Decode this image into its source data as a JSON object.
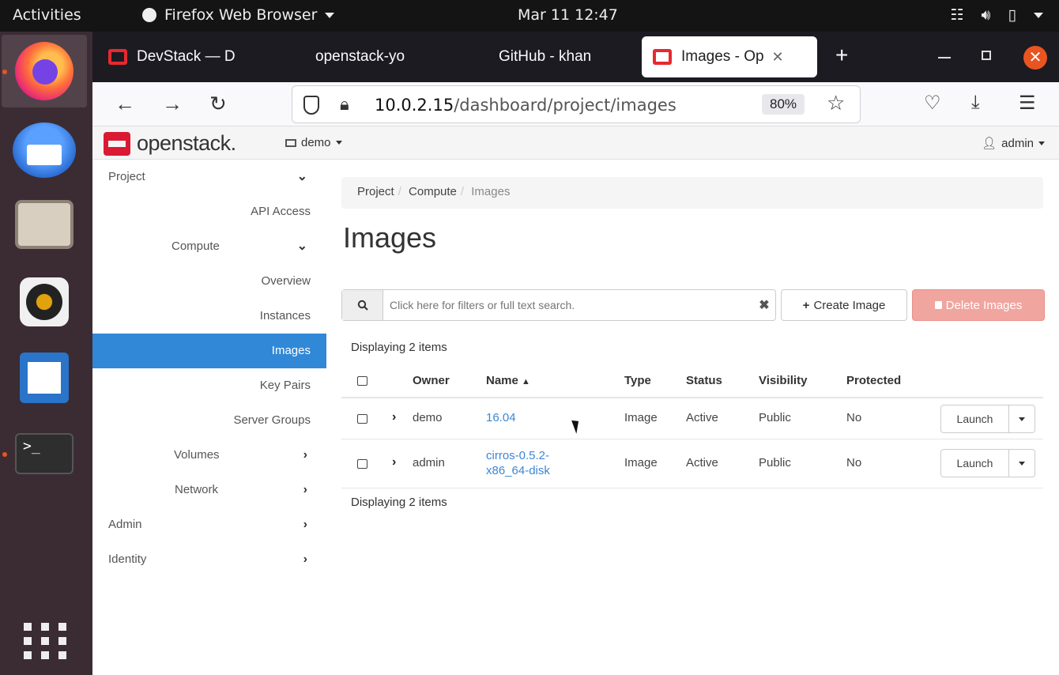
{
  "topbar": {
    "activities": "Activities",
    "app_menu": "Firefox Web Browser",
    "clock": "Mar 11  12:47"
  },
  "browser": {
    "tabs": [
      {
        "label": "DevStack — D"
      },
      {
        "label": "openstack-yo"
      },
      {
        "label": "GitHub - khan"
      },
      {
        "label": "Images - Op"
      }
    ],
    "url_host": "10.0.2.15",
    "url_path": "/dashboard/project/images",
    "zoom": "80%"
  },
  "header": {
    "logo_text": "openstack.",
    "project": "demo",
    "user": "admin"
  },
  "sidebar": {
    "items": [
      {
        "label": "Project"
      },
      {
        "label": "API Access"
      },
      {
        "label": "Compute"
      },
      {
        "label": "Overview"
      },
      {
        "label": "Instances"
      },
      {
        "label": "Images"
      },
      {
        "label": "Key Pairs"
      },
      {
        "label": "Server Groups"
      },
      {
        "label": "Volumes"
      },
      {
        "label": "Network"
      },
      {
        "label": "Admin"
      },
      {
        "label": "Identity"
      }
    ]
  },
  "main": {
    "breadcrumb": [
      "Project",
      "Compute",
      "Images"
    ],
    "title": "Images",
    "search_placeholder": "Click here for filters or full text search.",
    "create_label": "Create Image",
    "delete_label": "Delete Images",
    "count_text": "Displaying 2 items",
    "columns": [
      "Owner",
      "Name",
      "Type",
      "Status",
      "Visibility",
      "Protected"
    ],
    "rows": [
      {
        "owner": "demo",
        "name": "16.04",
        "type": "Image",
        "status": "Active",
        "visibility": "Public",
        "protected": "No",
        "action": "Launch"
      },
      {
        "owner": "admin",
        "name_line1": "cirros-0.5.2-",
        "name_line2": "x86_64-disk",
        "type": "Image",
        "status": "Active",
        "visibility": "Public",
        "protected": "No",
        "action": "Launch"
      }
    ]
  },
  "colors": {
    "selected_nav": "#3088d6",
    "link": "#3a87d6",
    "delete_button": "#f0a59f",
    "openstack_red": "#da1a32",
    "ubuntu_orange": "#e95420"
  }
}
